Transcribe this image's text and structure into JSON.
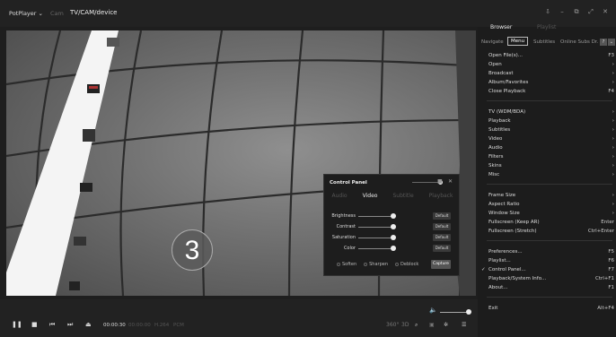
{
  "titlebar": {
    "app_name": "PotPlayer",
    "app_dropdown": "⌄",
    "separator": "Cam",
    "source": "TV/CAM/device"
  },
  "video": {
    "countdown": "3"
  },
  "control_panel": {
    "title": "Control Panel",
    "close": "✕",
    "pin": "■",
    "tabs": [
      "Audio",
      "Video",
      "Subtitle",
      "Playback"
    ],
    "active_tab": "Video",
    "rows": [
      {
        "label": "Brightness",
        "default_label": "Default",
        "level": 1.0
      },
      {
        "label": "Contrast",
        "default_label": "Default",
        "level": 1.0
      },
      {
        "label": "Saturation",
        "default_label": "Default",
        "level": 1.0
      },
      {
        "label": "Color",
        "default_label": "Default",
        "level": 1.0
      }
    ],
    "options": [
      "Soften",
      "Sharpen",
      "Deblock"
    ],
    "capture_label": "Capture"
  },
  "controls": {
    "time_current": "00:00:30",
    "time_total": "00:00:00",
    "codec": "H.264",
    "format": "PCM",
    "volume_level": 0.9
  },
  "sidebar": {
    "tab_browser": "Browser",
    "tab_playlist": "Playlist",
    "subtabs": [
      "Navigate",
      "Menu",
      "Subtitles",
      "Online Subs Dr."
    ],
    "active_subtab": "Menu",
    "sections": [
      [
        {
          "label": "Open File(s)...",
          "shortcut": "F3"
        },
        {
          "label": "Open",
          "shortcut": "›"
        },
        {
          "label": "Broadcast",
          "shortcut": "›"
        },
        {
          "label": "Album/Favorites",
          "shortcut": "›"
        },
        {
          "label": "Close Playback",
          "shortcut": "F4"
        }
      ],
      [
        {
          "label": "TV (WDM/BDA)",
          "shortcut": "›"
        },
        {
          "label": "Playback",
          "shortcut": "›"
        },
        {
          "label": "Subtitles",
          "shortcut": "›"
        },
        {
          "label": "Video",
          "shortcut": "›"
        },
        {
          "label": "Audio",
          "shortcut": "›"
        },
        {
          "label": "Filters",
          "shortcut": "›"
        },
        {
          "label": "Skins",
          "shortcut": "›"
        },
        {
          "label": "Misc",
          "shortcut": "›"
        }
      ],
      [
        {
          "label": "Frame Size",
          "shortcut": "›"
        },
        {
          "label": "Aspect Ratio",
          "shortcut": "›"
        },
        {
          "label": "Window Size",
          "shortcut": "›"
        },
        {
          "label": "Fullscreen (Keep AR)",
          "shortcut": "Enter"
        },
        {
          "label": "Fullscreen (Stretch)",
          "shortcut": "Ctrl+Enter"
        }
      ],
      [
        {
          "label": "Preferences...",
          "shortcut": "F5"
        },
        {
          "label": "Playlist...",
          "shortcut": "F6"
        },
        {
          "label": "Control Panel...",
          "shortcut": "F7",
          "checked": true
        },
        {
          "label": "Playback/System Info...",
          "shortcut": "Ctrl+F1"
        },
        {
          "label": "About...",
          "shortcut": "F1"
        }
      ],
      [
        {
          "label": "Exit",
          "shortcut": "Alt+F4"
        }
      ]
    ]
  }
}
